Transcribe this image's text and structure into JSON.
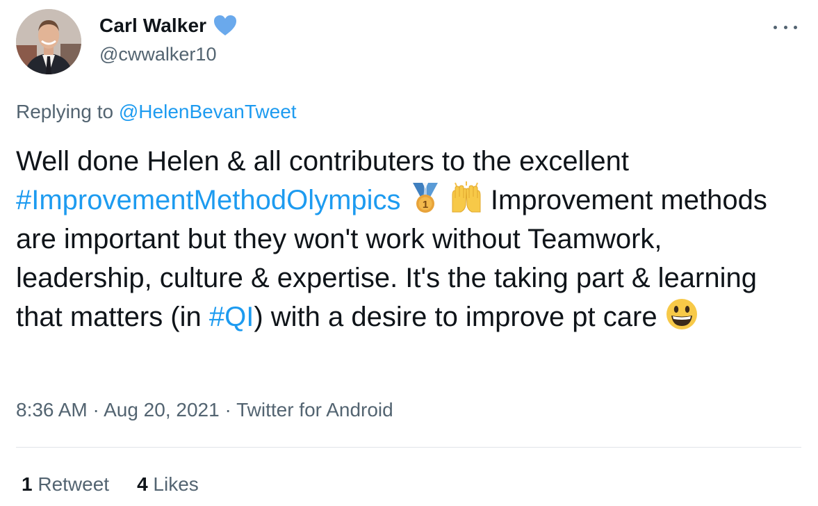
{
  "author": {
    "display_name": "Carl Walker",
    "handle": "@cwwalker10",
    "avatar_icon": "profile-photo",
    "verified_icon": "verified-badge-icon",
    "verified_color": "#3d97ea"
  },
  "reply": {
    "prefix": "Replying to ",
    "to": "@HelenBevanTweet"
  },
  "tweet": {
    "seg1": "Well done Helen & all contributers to the excellent ",
    "hashtag1": "#ImprovementMethodOlympics",
    "seg2": " Improvement methods are important but they won't work without Teamwork, leadership, culture & expertise. It's the taking part & learning that matters (in ",
    "hashtag2": "#QI",
    "seg3": ") with a desire to improve pt care ",
    "emoji": [
      "first-place-medal",
      "raising-hands",
      "smiling-face-open-mouth"
    ]
  },
  "meta": {
    "time": "8:36 AM",
    "sep1": " · ",
    "date": "Aug 20, 2021",
    "sep2": " · ",
    "source": "Twitter for Android"
  },
  "stats": {
    "retweet_count": "1",
    "retweet_label": " Retweet",
    "like_count": "4",
    "like_label": " Likes"
  },
  "colors": {
    "link": "#1d9bf0",
    "secondary_text": "#536471",
    "primary_text": "#0f1419"
  }
}
